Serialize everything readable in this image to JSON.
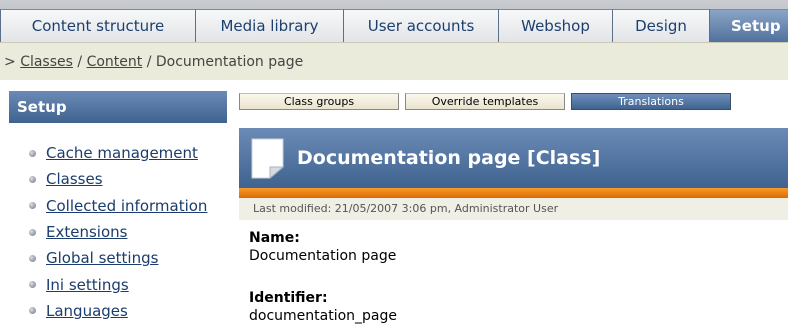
{
  "top_tabs": [
    {
      "label": "Content structure",
      "active": false
    },
    {
      "label": "Media library",
      "active": false
    },
    {
      "label": "User accounts",
      "active": false
    },
    {
      "label": "Webshop",
      "active": false
    },
    {
      "label": "Design",
      "active": false
    },
    {
      "label": "Setup",
      "active": true
    }
  ],
  "breadcrumb": {
    "prefix": ">",
    "items": [
      "Classes",
      "Content"
    ],
    "separator": "/",
    "current": "Documentation page"
  },
  "sidebar": {
    "title": "Setup",
    "items": [
      {
        "label": "Cache management"
      },
      {
        "label": "Classes"
      },
      {
        "label": "Collected information"
      },
      {
        "label": "Extensions"
      },
      {
        "label": "Global settings"
      },
      {
        "label": "Ini settings"
      },
      {
        "label": "Languages"
      }
    ]
  },
  "subtabs": [
    {
      "label": "Class groups",
      "active": false
    },
    {
      "label": "Override templates",
      "active": false
    },
    {
      "label": "Translations",
      "active": true
    }
  ],
  "main": {
    "title": "Documentation page [Class]",
    "last_modified": "Last modified: 21/05/2007 3:06 pm, Administrator User",
    "fields": [
      {
        "label": "Name:",
        "value": "Documentation page"
      },
      {
        "label": "Identifier:",
        "value": "documentation_page"
      }
    ],
    "icon": "document-icon"
  },
  "colors": {
    "header_blue": "#4f719d",
    "accent_orange": "#f08a18",
    "link": "#1a3d6d",
    "breadcrumb_bg": "#ebebdc"
  }
}
